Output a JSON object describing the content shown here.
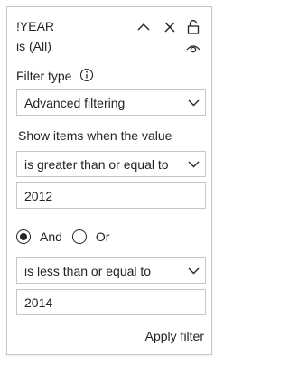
{
  "header": {
    "title": "!YEAR",
    "subtitle": "is (All)",
    "icons": [
      "chevron-up-icon",
      "close-icon",
      "lock-icon",
      "eye-icon"
    ]
  },
  "filter_type": {
    "label": "Filter type",
    "info_icon": "info-icon",
    "selected": "Advanced filtering"
  },
  "condition": {
    "label": "Show items when the value",
    "first_operator": "is greater than or equal to",
    "first_value": "2012",
    "logic_options": [
      "And",
      "Or"
    ],
    "logic_selected": "And",
    "second_operator": "is less than or equal to",
    "second_value": "2014"
  },
  "apply_label": "Apply filter"
}
